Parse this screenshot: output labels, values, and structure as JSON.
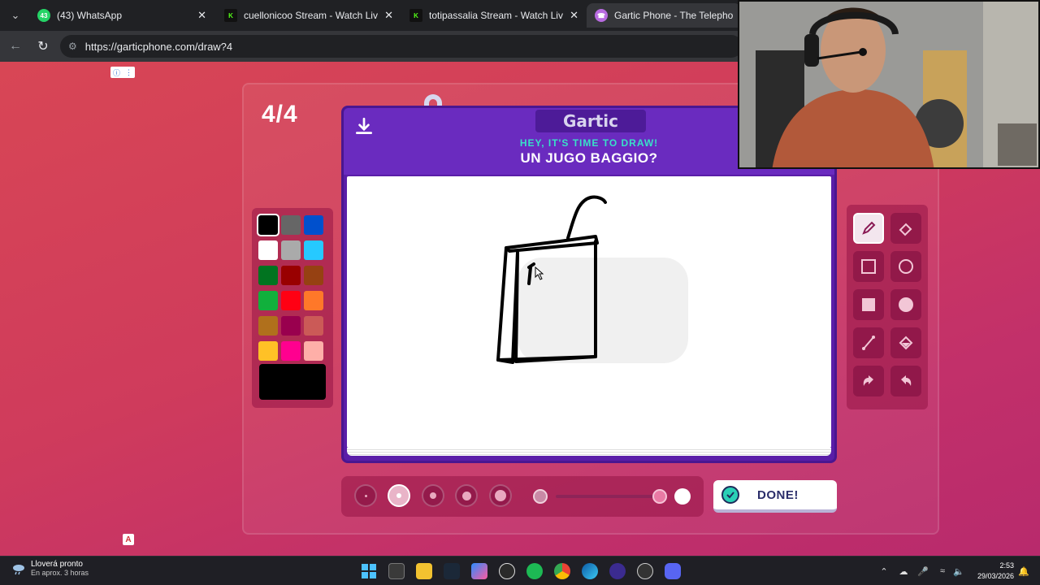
{
  "browser": {
    "tabs": [
      {
        "title": "(43) WhatsApp",
        "badge": "43",
        "favicon_color": "#25d366",
        "active": false
      },
      {
        "title": "cuellonicoo Stream - Watch Live on",
        "favicon": "K",
        "favicon_color": "#53fc18",
        "active": false
      },
      {
        "title": "totipassalia Stream - Watch Live on",
        "favicon": "K",
        "favicon_color": "#53fc18",
        "active": false
      },
      {
        "title": "Gartic Phone - The Telephone Game",
        "favicon_color": "#b86be0",
        "active": true
      }
    ],
    "url": "https://garticphone.com/draw?4"
  },
  "game": {
    "round": "4/4",
    "brand": "Gartic",
    "heading": "HEY, IT'S TIME TO DRAW!",
    "phrase": "UN JUGO BAGGIO?",
    "done_label": "DONE!",
    "palette": [
      "#000000",
      "#666666",
      "#0050cd",
      "#ffffff",
      "#aaaaaa",
      "#26c9ff",
      "#017420",
      "#990000",
      "#964112",
      "#11b03c",
      "#ff0013",
      "#ff7829",
      "#b0701c",
      "#99004e",
      "#cb5a57",
      "#ffc126",
      "#ff008f",
      "#feafa8"
    ],
    "selected_color": "#000000",
    "selected_tool": "pencil",
    "tools": [
      "pencil-icon",
      "eraser-icon",
      "rect-outline-icon",
      "circle-outline-icon",
      "rect-filled-icon",
      "circle-filled-icon",
      "line-icon",
      "fill-bucket-icon",
      "undo-icon",
      "redo-icon"
    ],
    "brush_sizes": 5,
    "selected_brush_size": 2
  },
  "taskbar": {
    "weather_title": "Lloverá pronto",
    "weather_sub": "En aprox. 3 horas",
    "time": "2:53",
    "date": "29/03/2026"
  }
}
